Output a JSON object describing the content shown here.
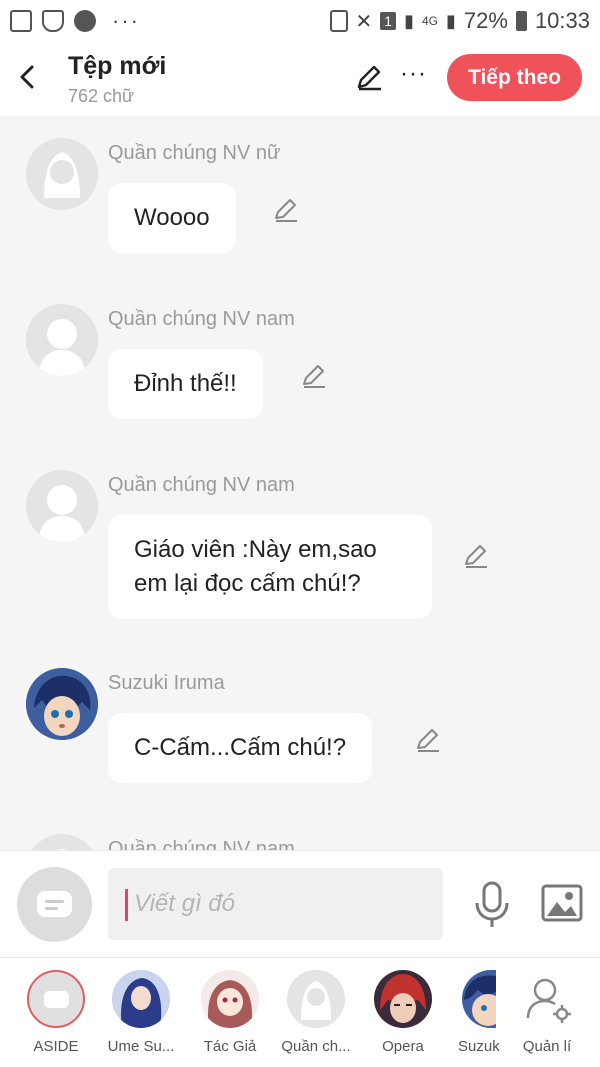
{
  "status_bar": {
    "battery": "72%",
    "time": "10:33",
    "network": "4G",
    "sim": "1",
    "more": "···"
  },
  "header": {
    "title": "Tệp mới",
    "subtitle": "762 chữ",
    "next_label": "Tiếp theo",
    "more": "···"
  },
  "messages": [
    {
      "name": "Quần chúng NV nữ",
      "text": "Woooo"
    },
    {
      "name": "Quần chúng NV nam",
      "text": "Đỉnh thế!!"
    },
    {
      "name": "Quần chúng NV nam",
      "text": "Giáo viên :Này em,sao\nem lại đọc cấm chú!?"
    },
    {
      "name": "Suzuki Iruma",
      "text": "C-Cấm...Cấm chú!?"
    },
    {
      "name": "Quần chúng NV nam",
      "text": ""
    }
  ],
  "composer": {
    "placeholder": "Viết gì đó"
  },
  "characters": [
    {
      "label": "ASIDE"
    },
    {
      "label": "Ume Su..."
    },
    {
      "label": "Tác Giả"
    },
    {
      "label": "Quần ch..."
    },
    {
      "label": "Opera"
    },
    {
      "label": "Suzuk"
    },
    {
      "label": "Quản lí"
    }
  ],
  "colors": {
    "accent": "#f0525a",
    "caret": "#e0427a",
    "background": "#f5f5f5"
  },
  "icons": [
    "back-arrow-icon",
    "pencil-icon",
    "more-icon",
    "mic-icon",
    "image-icon",
    "manage-user-icon",
    "aside-chat-icon"
  ]
}
